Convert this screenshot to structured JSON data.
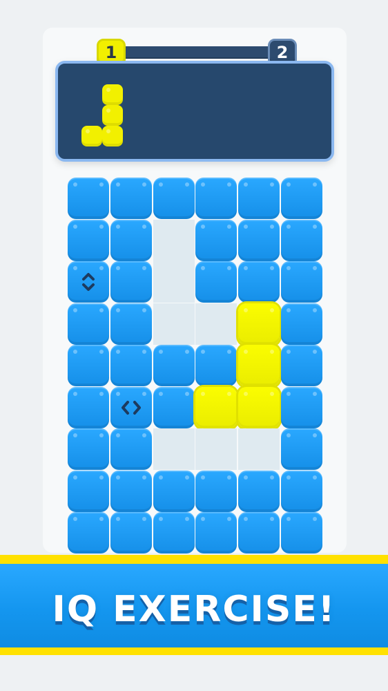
{
  "progress": {
    "current_level": "1",
    "next_level": "2",
    "completion_fraction": 0.05
  },
  "board": {
    "rows": [
      [
        "blue",
        "blue",
        "blue",
        "blue",
        "blue",
        "blue"
      ],
      [
        "blue",
        "blue",
        "empty",
        "blue",
        "blue",
        "blue"
      ],
      [
        "blue",
        "blue",
        "empty",
        "blue",
        "blue",
        "blue"
      ],
      [
        "blue",
        "blue",
        "empty",
        "empty",
        "yellow",
        "blue"
      ],
      [
        "blue",
        "blue",
        "blue",
        "blue",
        "yellow",
        "blue"
      ],
      [
        "blue",
        "blue",
        "blue",
        "yellow",
        "yellow",
        "blue"
      ],
      [
        "blue",
        "blue",
        "empty",
        "empty",
        "empty",
        "blue"
      ],
      [
        "blue",
        "blue",
        "blue",
        "blue",
        "blue",
        "blue"
      ],
      [
        "blue",
        "blue",
        "blue",
        "blue",
        "blue",
        "blue"
      ]
    ],
    "icons": [
      {
        "row": 2,
        "col": 0,
        "name": "vertical-arrows-icon"
      },
      {
        "row": 5,
        "col": 1,
        "name": "horizontal-arrows-icon"
      }
    ]
  },
  "target_piece": {
    "cells": [
      {
        "row": 0,
        "col": 1
      },
      {
        "row": 1,
        "col": 1
      },
      {
        "row": 2,
        "col": 0
      },
      {
        "row": 2,
        "col": 1
      }
    ]
  },
  "banner": {
    "text": "IQ EXERCISE!"
  },
  "colors": {
    "accent_yellow": "#f2f000",
    "tile_blue": "#1d9cff",
    "dark_panel": "#26486d",
    "banner_blue": "#1496ef",
    "banner_stripe": "#ffe100"
  }
}
